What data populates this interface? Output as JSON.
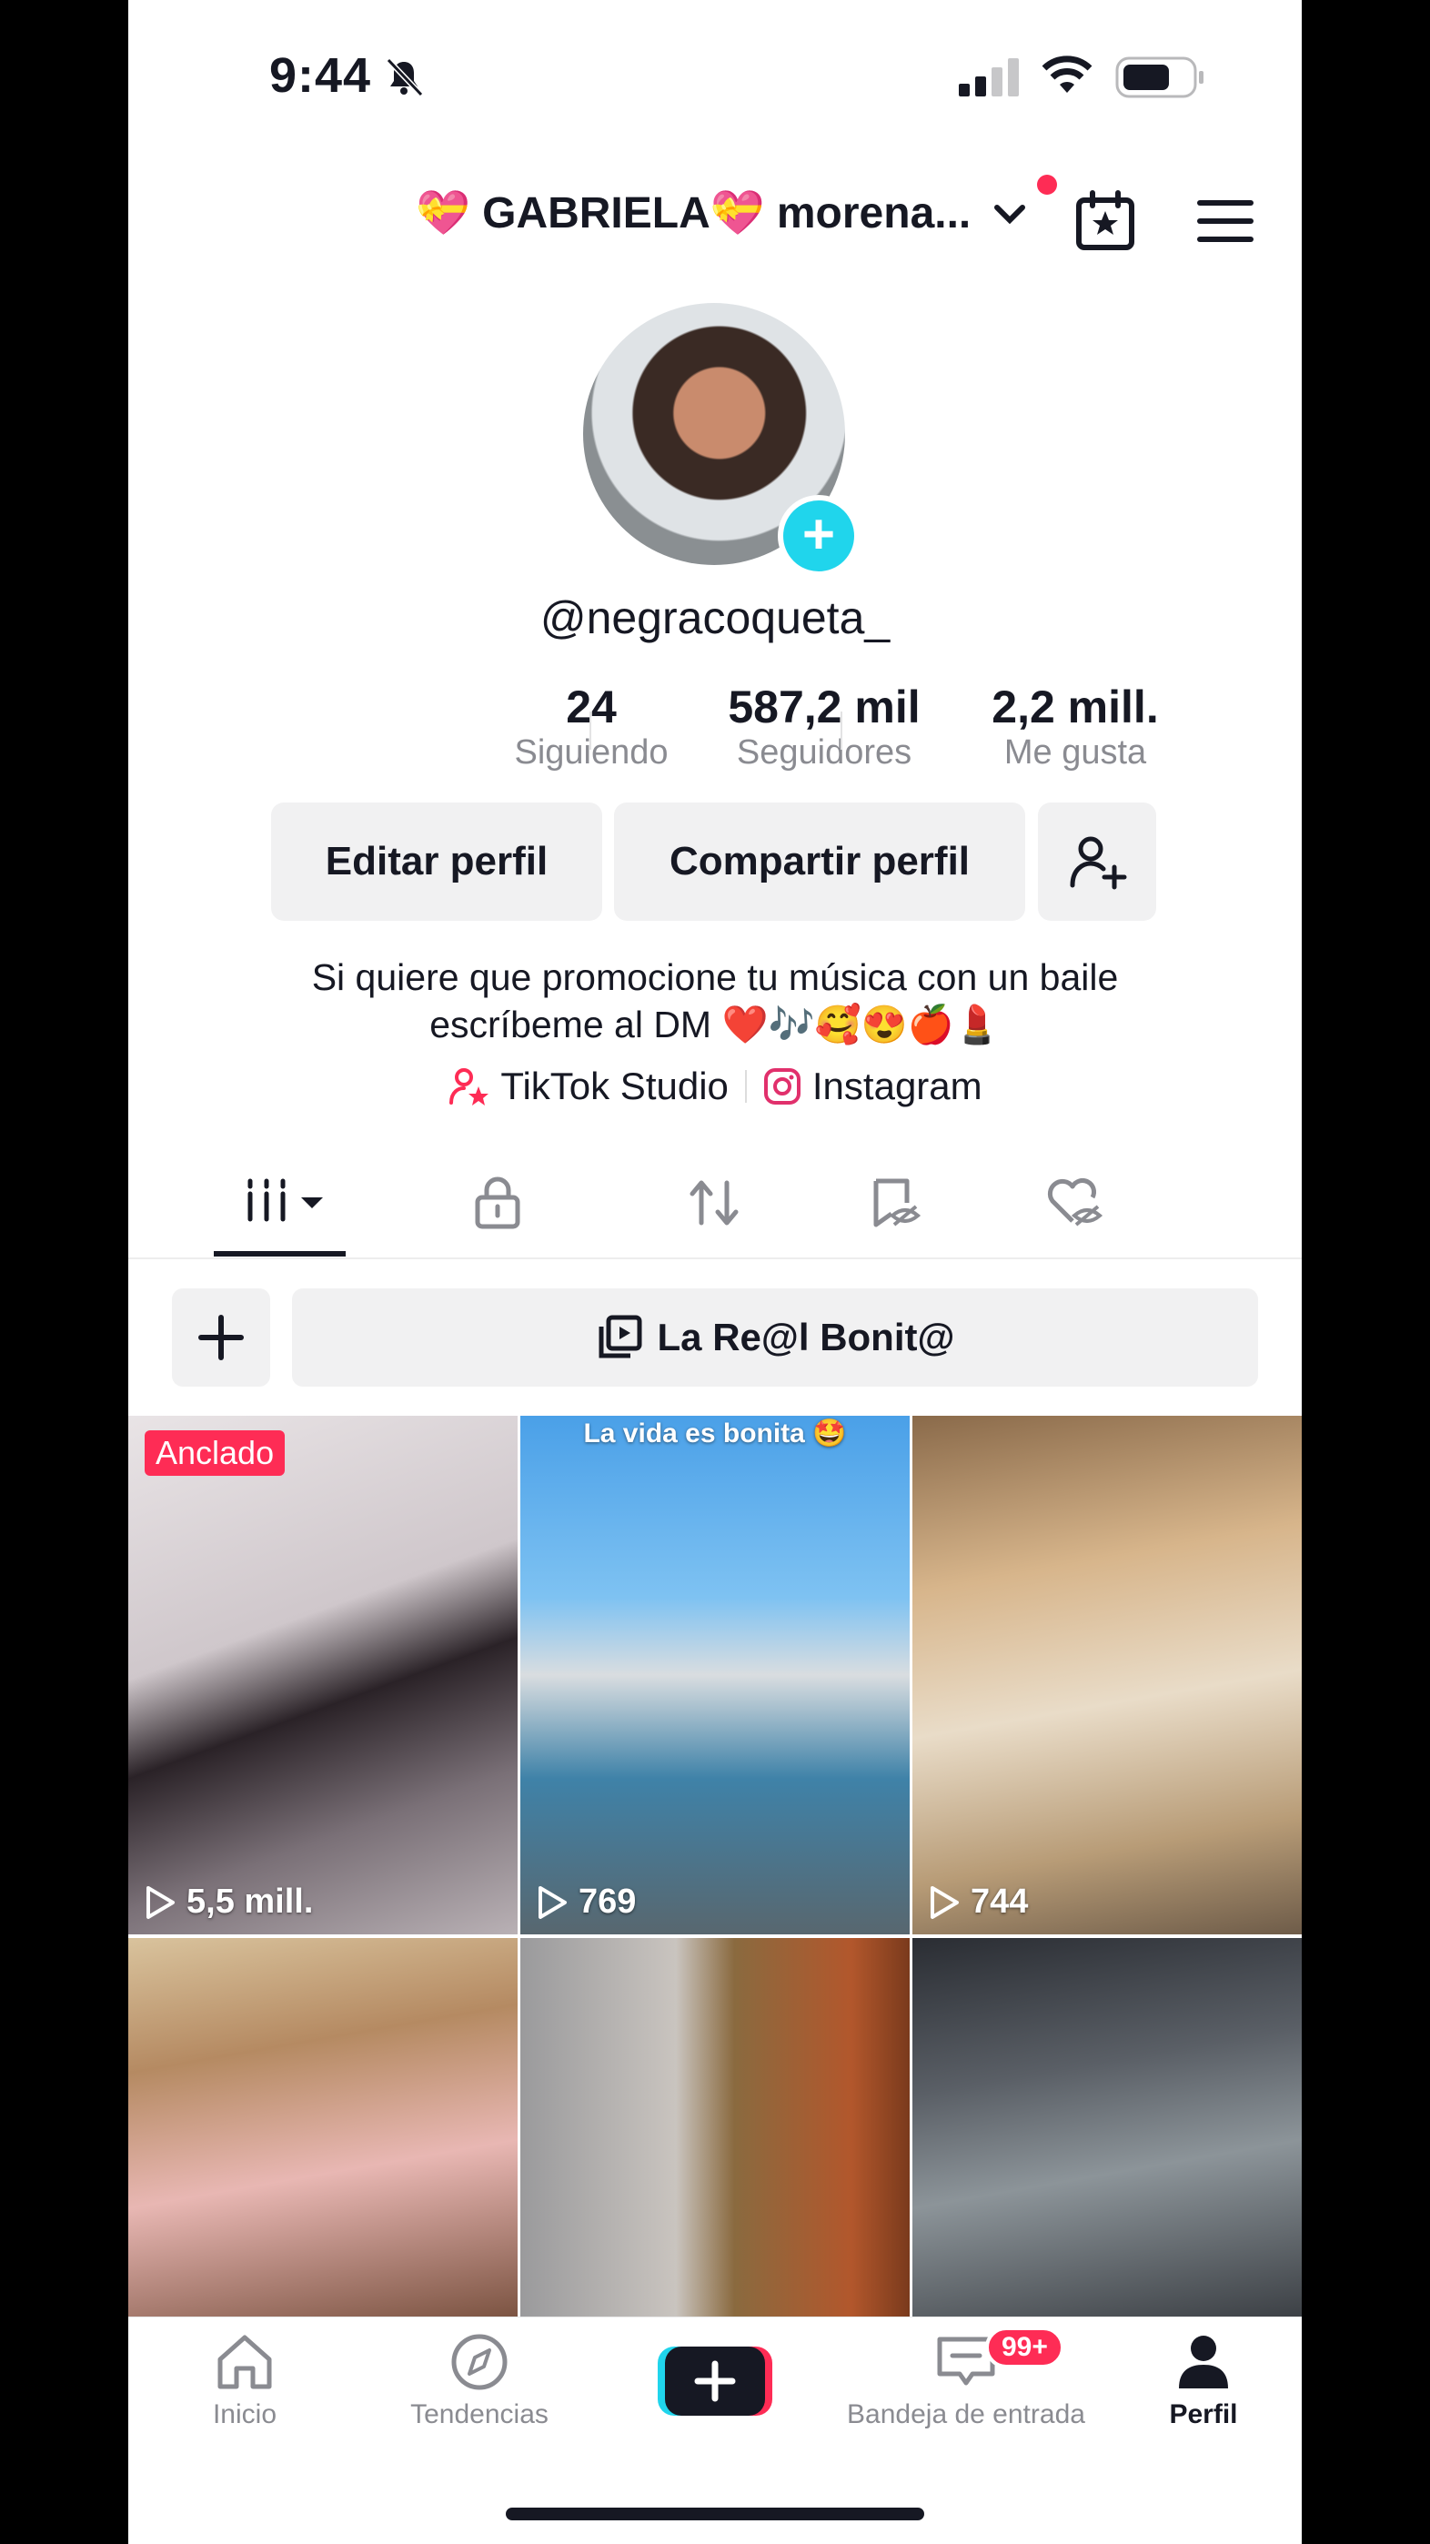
{
  "status_bar": {
    "time": "9:44"
  },
  "header": {
    "display_name": "💝 GABRIELA💝 morena..."
  },
  "profile": {
    "username": "@negracoqueta_"
  },
  "stats": [
    {
      "value": "24",
      "label": "Siguiendo"
    },
    {
      "value": "587,2 mil",
      "label": "Seguidores"
    },
    {
      "value": "2,2 mill.",
      "label": "Me gusta"
    }
  ],
  "actions": {
    "edit": "Editar perfil",
    "share": "Compartir perfil"
  },
  "bio": {
    "line1": "Si quiere que promocione tu música con un baile",
    "line2": "escríbeme  al DM ❤️🎶🥰😍🍎💄"
  },
  "links": {
    "studio": "TikTok Studio",
    "instagram": "Instagram"
  },
  "playlist": {
    "name": "La Re@l Bonit@"
  },
  "videos": [
    {
      "badge": "Anclado",
      "views": "5,5 mill."
    },
    {
      "caption": "La vida es bonita 🤩",
      "views": "769"
    },
    {
      "views": "744"
    }
  ],
  "nav": {
    "home": "Inicio",
    "discover": "Tendencias",
    "inbox": "Bandeja de entrada",
    "inbox_badge": "99+",
    "profile": "Perfil"
  },
  "colors": {
    "accent": "#fe2c55",
    "teal": "#20d5ec",
    "text": "#161823",
    "muted": "#8a8b91"
  }
}
